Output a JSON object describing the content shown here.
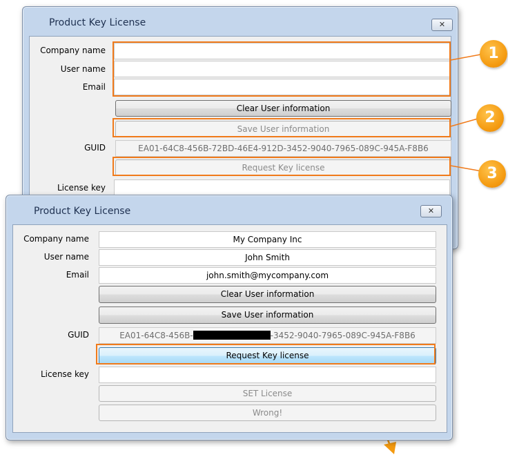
{
  "back_window": {
    "title": "Product Key License",
    "close_glyph": "✕",
    "labels": {
      "company": "Company name",
      "user": "User name",
      "email": "Email",
      "guid": "GUID",
      "license_key": "License key"
    },
    "values": {
      "company": "",
      "user": "",
      "email": ""
    },
    "buttons": {
      "clear": "Clear User information",
      "save": "Save User information",
      "request": "Request Key license"
    },
    "guid_value": "EA01-64C8-456B-72BD-46E4-912D-3452-9040-7965-089C-945A-F8B6"
  },
  "front_window": {
    "title": "Product Key License",
    "close_glyph": "✕",
    "labels": {
      "company": "Company name",
      "user": "User name",
      "email": "Email",
      "guid": "GUID",
      "license_key": "License key"
    },
    "values": {
      "company": "My Company Inc",
      "user": "John Smith",
      "email": "john.smith@mycompany.com",
      "license_key": ""
    },
    "buttons": {
      "clear": "Clear User information",
      "save": "Save User information",
      "request": "Request Key license",
      "set_license": "SET License",
      "status": "Wrong!"
    },
    "guid_prefix": "EA01-64C8-456B-",
    "guid_suffix": "-3452-9040-7965-089C-945A-F8B6"
  },
  "callouts": [
    "1",
    "2",
    "3"
  ],
  "colors": {
    "highlight": "#f07a1a",
    "badge": "#f49a10"
  }
}
